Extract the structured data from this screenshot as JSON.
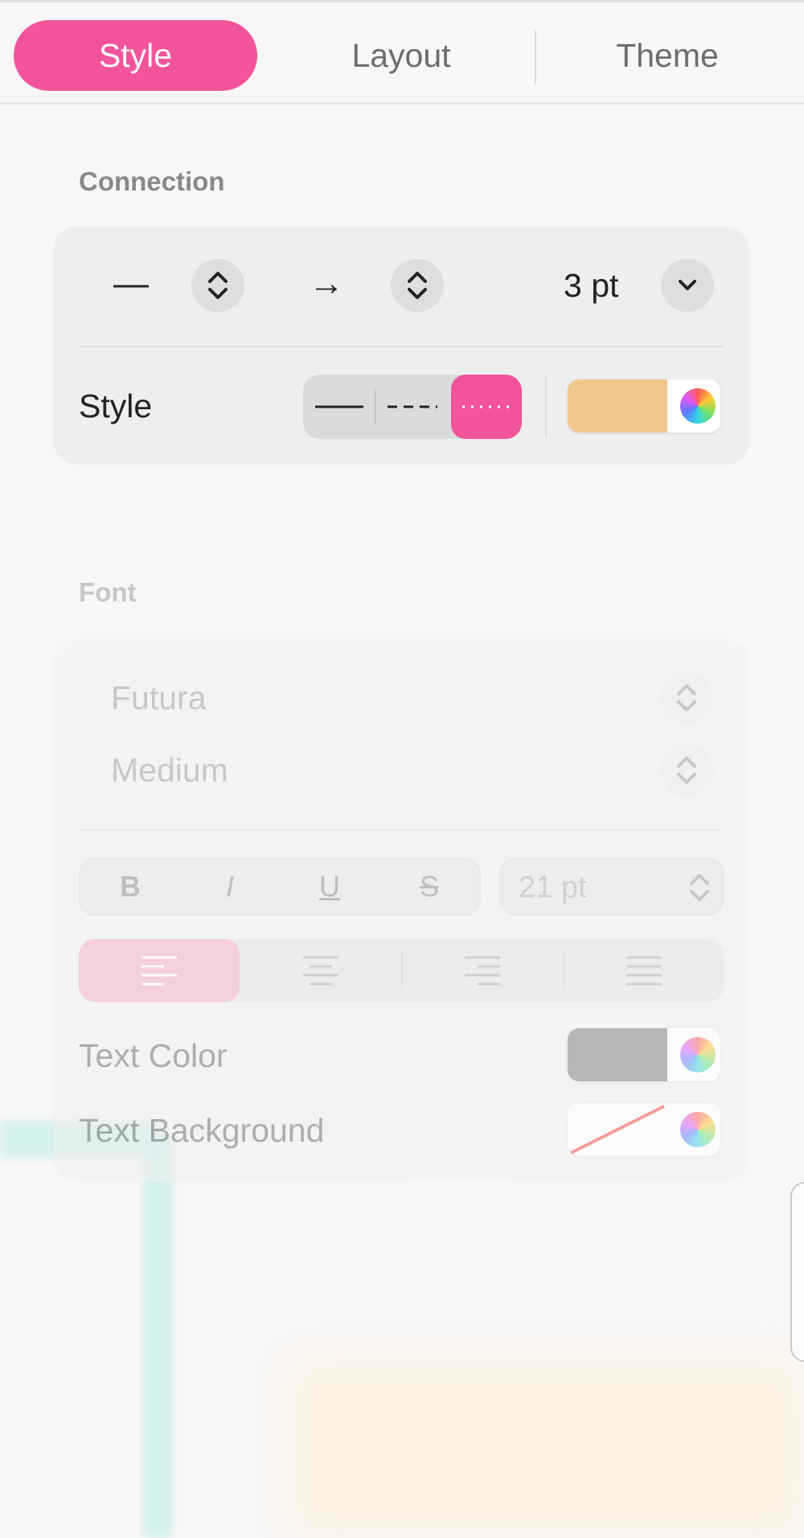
{
  "tabs": [
    {
      "label": "Style",
      "active": true
    },
    {
      "label": "Layout",
      "active": false
    },
    {
      "label": "Theme",
      "active": false
    }
  ],
  "connection": {
    "title": "Connection",
    "line_start": "—",
    "line_end": "→",
    "width_value": "3 pt",
    "style_label": "Style",
    "style_options": [
      "solid",
      "dashed",
      "dotted"
    ],
    "style_selected": "dotted",
    "color": "#f2c78e"
  },
  "font": {
    "title": "Font",
    "family": "Futura",
    "weight": "Medium",
    "bold": "B",
    "italic": "I",
    "underline": "U",
    "strike": "S",
    "size": "21 pt",
    "alignments": [
      "left",
      "center",
      "right",
      "justify"
    ],
    "alignment_selected": "left",
    "text_color_label": "Text Color",
    "text_color": "#b8b8b8",
    "text_background_label": "Text Background",
    "text_background": "none"
  },
  "colors": {
    "accent": "#f2549b"
  }
}
